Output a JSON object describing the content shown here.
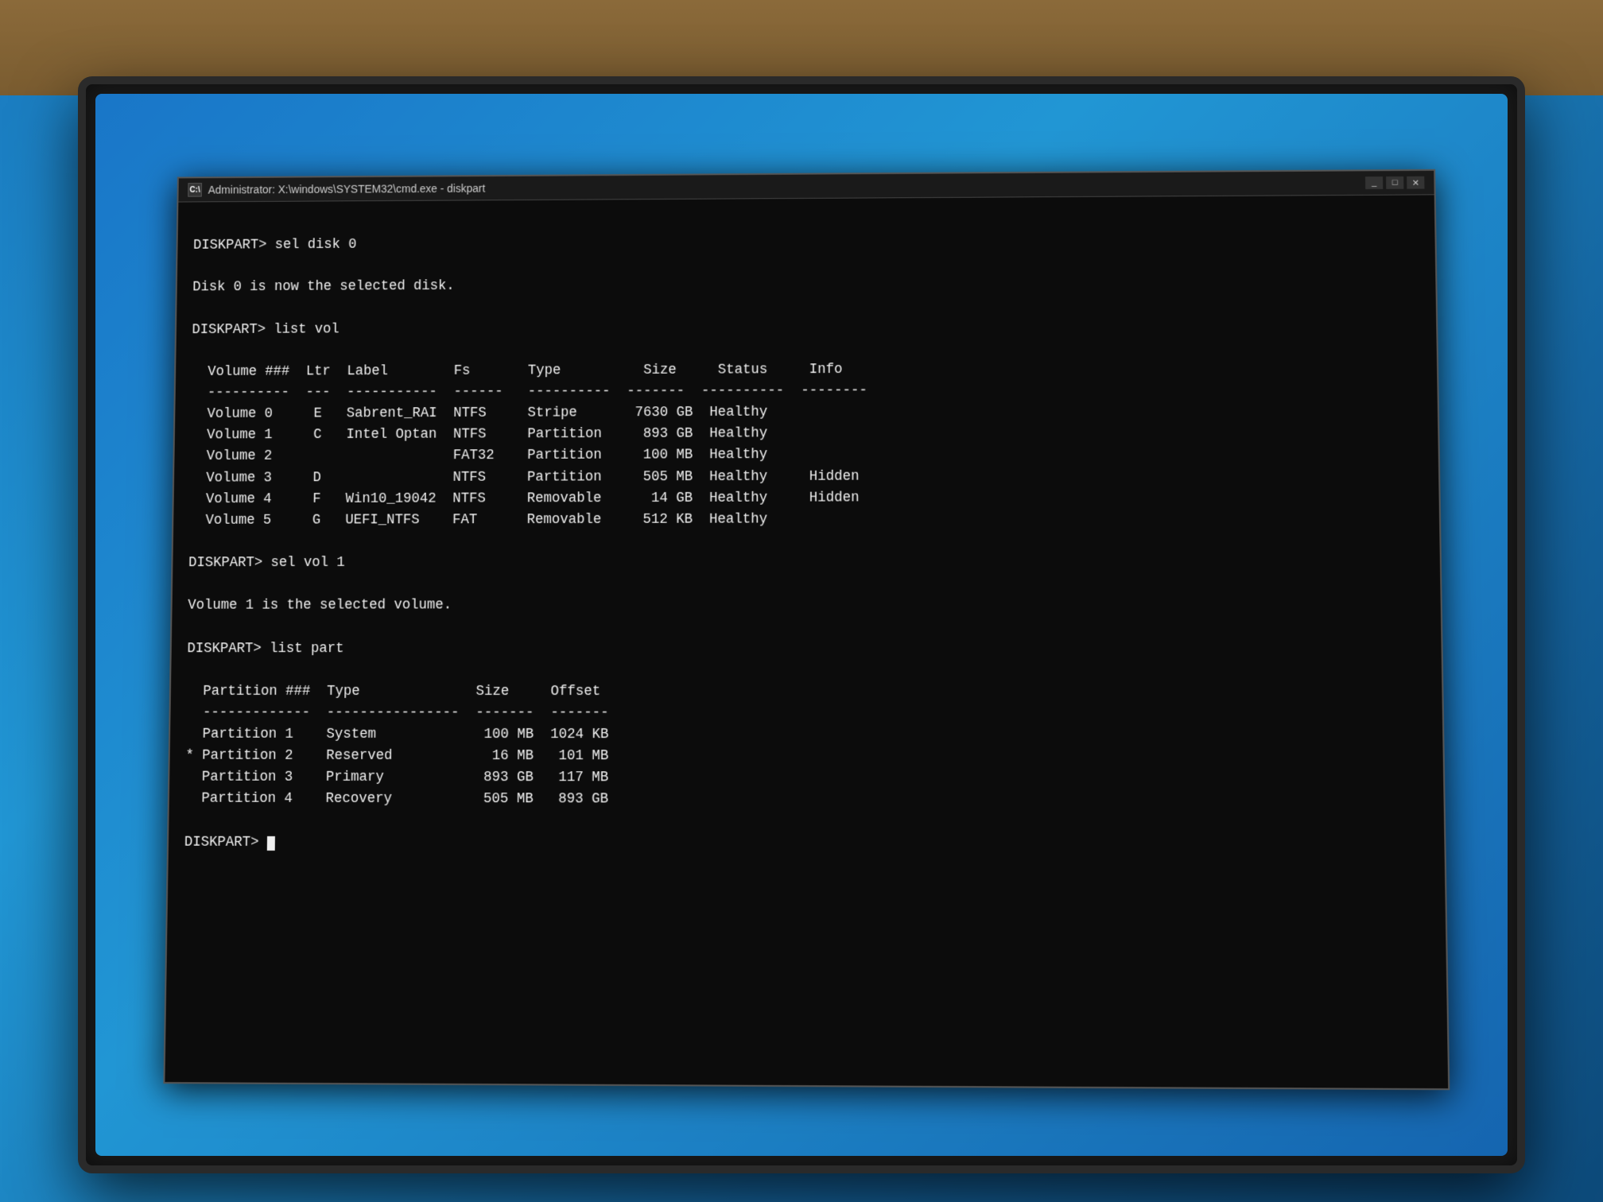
{
  "titleBar": {
    "icon": "C:\\",
    "title": "Administrator: X:\\windows\\SYSTEM32\\cmd.exe - diskpart"
  },
  "lines": [
    "",
    "DISKPART> sel disk 0",
    "",
    "Disk 0 is now the selected disk.",
    "",
    "DISKPART> list vol",
    "",
    "  Volume ###  Ltr  Label        Fs       Type          Size     Status     Info",
    "  ----------  ---  -----------  ------   ----------  -------  ----------  --------",
    "  Volume 0     E   Sabrent_RAI  NTFS     Stripe       7630 GB  Healthy",
    "  Volume 1     C   Intel Optan  NTFS     Partition     893 GB  Healthy",
    "  Volume 2                      FAT32    Partition     100 MB  Healthy",
    "  Volume 3     D                NTFS     Partition     505 MB  Healthy     Hidden",
    "  Volume 4     F   Win10_19042  NTFS     Removable      14 GB  Healthy     Hidden",
    "  Volume 5     G   UEFI_NTFS    FAT      Removable     512 KB  Healthy",
    "",
    "DISKPART> sel vol 1",
    "",
    "Volume 1 is the selected volume.",
    "",
    "DISKPART> list part",
    "",
    "  Partition ###  Type              Size     Offset",
    "  -------------  ----------------  -------  -------",
    "  Partition 1    System             100 MB  1024 KB",
    "* Partition 2    Reserved            16 MB   101 MB",
    "  Partition 3    Primary            893 GB   117 MB",
    "  Partition 4    Recovery           505 MB   893 GB",
    "",
    "DISKPART> "
  ]
}
